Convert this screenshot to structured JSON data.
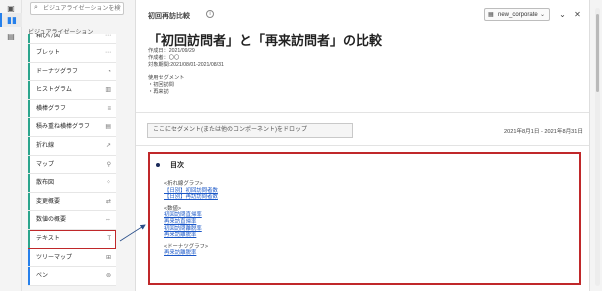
{
  "colors": {
    "brand": "#2680eb",
    "highlight": "#c0282a",
    "link": "#1a57c7",
    "bullet": "#1a2a5a"
  },
  "rail": {
    "icons": [
      "panel-icon",
      "visualizations-icon",
      "table-icon"
    ]
  },
  "sidebar": {
    "search_placeholder": "ビジュアライゼーションを検索",
    "section_label": "ビジュアライゼーション",
    "items": [
      {
        "label": "箱ひげ図",
        "icon": "box-plot-icon",
        "color": "#2ca58d",
        "clipped": true
      },
      {
        "label": "ブレット",
        "icon": "bullet-icon",
        "color": "#2ca58d"
      },
      {
        "label": "ドーナツグラフ",
        "icon": "donut-icon",
        "color": "#2ca58d"
      },
      {
        "label": "ヒストグラム",
        "icon": "histogram-icon",
        "color": "#2ca58d"
      },
      {
        "label": "横棒グラフ",
        "icon": "horizontal-bar-icon",
        "color": "#2ca58d"
      },
      {
        "label": "積み重ね横棒グラフ",
        "icon": "stacked-bar-icon",
        "color": "#2ca58d"
      },
      {
        "label": "折れ線",
        "icon": "line-chart-icon",
        "color": "#2ca58d"
      },
      {
        "label": "マップ",
        "icon": "map-icon",
        "color": "#2ca58d"
      },
      {
        "label": "散布図",
        "icon": "scatter-icon",
        "color": "#2ca58d"
      },
      {
        "label": "変更概要",
        "icon": "change-summary-icon",
        "color": "#2ca58d"
      },
      {
        "label": "数値の概要",
        "icon": "summary-number-icon",
        "color": "#2ca58d"
      },
      {
        "label": "テキスト",
        "icon": "text-icon",
        "color": "#2ca58d",
        "highlighted": true
      },
      {
        "label": "ツリーマップ",
        "icon": "treemap-icon",
        "color": "#2680eb"
      },
      {
        "label": "ベン",
        "icon": "venn-icon",
        "color": "#2680eb"
      }
    ]
  },
  "panel": {
    "title": "初回再訪比較",
    "dropdown_value": "new_corporate",
    "main_title": "「初回訪問者」と「再来訪問者」の比較",
    "created_date": "作成日：2021/09/29",
    "author": "作成者：〇〇",
    "period": "対象期間:2021/08/01-2021/08/31",
    "segment_label": "使用セグメント",
    "segments": [
      "・初回訪問",
      "・再来訪"
    ],
    "drop_placeholder": "ここにセグメント(または他のコンポーネント)をドロップ",
    "date_range": "2021年8月1日 - 2021年8月31日"
  },
  "text_panel": {
    "heading": "目次",
    "groups": [
      {
        "title": "<折れ線グラフ>",
        "links": [
          "【日別】初回訪問者数",
          "【日別】再訪訪問者数"
        ]
      },
      {
        "title": "<数値>",
        "links": [
          "初回訪問直帰率",
          "再来訪直帰率",
          "初回訪問離脱率",
          "再来訪離脱率"
        ]
      },
      {
        "title": "<ドーナツグラフ>",
        "links": [
          "再来訪離脱率"
        ]
      }
    ]
  }
}
